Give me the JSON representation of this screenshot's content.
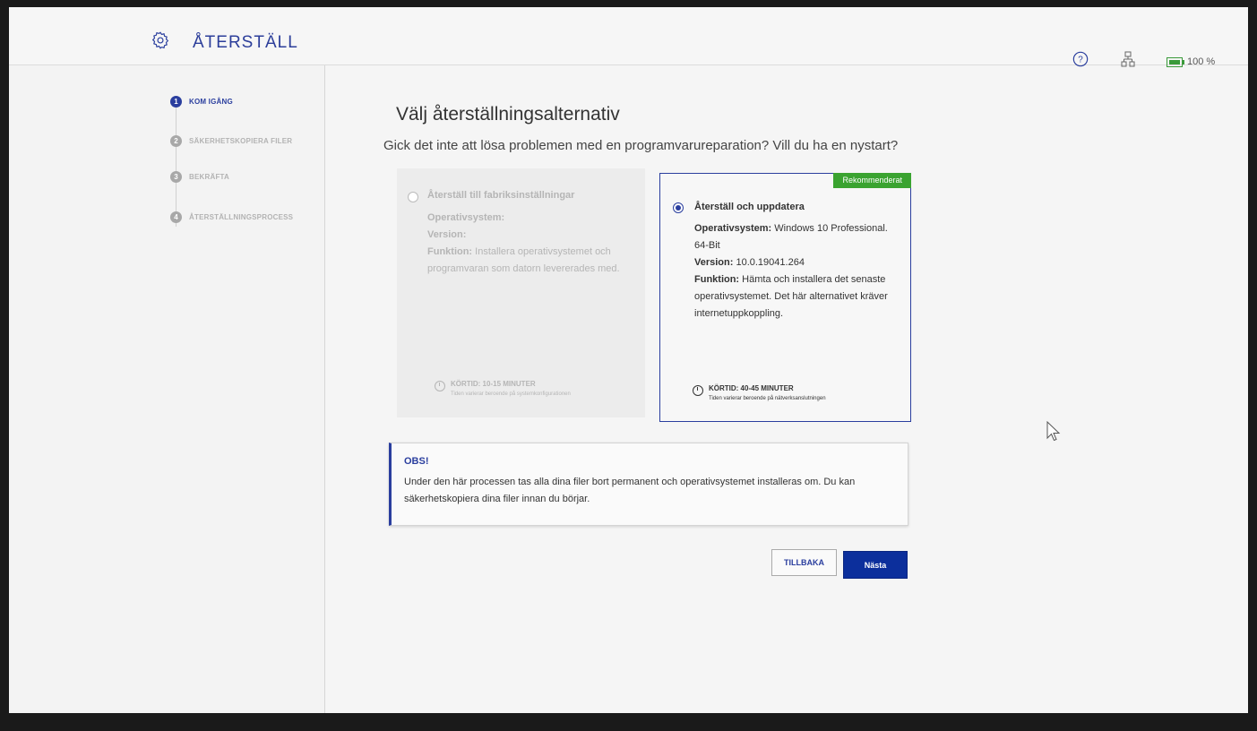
{
  "header": {
    "app_title": "ÅTERSTÄLL",
    "battery_text": "100 %",
    "icons": [
      "gear-icon",
      "help-icon",
      "network-icon",
      "battery-icon"
    ]
  },
  "sidebar": {
    "steps": [
      {
        "num": "1",
        "label": "KOM IGÅNG",
        "active": true
      },
      {
        "num": "2",
        "label": "SÄKERHETSKOPIERA FILER",
        "active": false
      },
      {
        "num": "3",
        "label": "BEKRÄFTA",
        "active": false
      },
      {
        "num": "4",
        "label": "ÅTERSTÄLLNINGSPROCESS",
        "active": false
      }
    ]
  },
  "main": {
    "title": "Välj återställningsalternativ",
    "subtitle": "Gick det inte att lösa problemen med en programvarureparation? Vill du ha en nystart?",
    "options": [
      {
        "title": "Återställ till fabriksinställningar",
        "os_label": "Operativsystem:",
        "os_value": "",
        "version_label": "Version:",
        "version_value": "",
        "function_label": "Funktion:",
        "function_value": "Installera operativsystemet och programvaran som datorn levererades med.",
        "runtime_label": "KÖRTID: 10-15 MINUTER",
        "runtime_note": "Tiden varierar beroende på systemkonfigurationen",
        "selected": false
      },
      {
        "badge": "Rekommenderat",
        "title": "Återställ och uppdatera",
        "os_label": "Operativsystem:",
        "os_value": "Windows 10 Professional. 64-Bit",
        "version_label": "Version:",
        "version_value": "10.0.19041.264",
        "function_label": "Funktion:",
        "function_value": "Hämta och installera det senaste operativsystemet. Det här alternativet kräver internetuppkoppling.",
        "runtime_label": "KÖRTID: 40-45 MINUTER",
        "runtime_note": "Tiden varierar beroende på nätverksanslutningen",
        "selected": true
      }
    ],
    "notice": {
      "title": "OBS!",
      "body": "Under den här processen tas alla dina filer bort permanent och operativsystemet installeras om. Du kan säkerhetskopiera dina filer innan du börjar."
    },
    "buttons": {
      "back": "TILLBAKA",
      "next": "Nästa"
    }
  },
  "colors": {
    "accent": "#2a3e9e",
    "primary_button": "#0c2f9c",
    "recommended": "#3aa330"
  }
}
